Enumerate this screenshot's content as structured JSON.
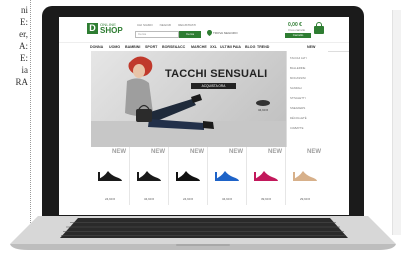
{
  "article_fragments": [
    "ni",
    "E:",
    "er,",
    "A:",
    "E:",
    "ia",
    "RA"
  ],
  "site": {
    "logo_letter": "D",
    "logo_top": "ONLINE",
    "logo_main": "SHOP",
    "top_links": [
      "CHI SIAMO",
      "NEGOZI",
      "REGISTRATI"
    ],
    "search_placeholder": "Cerca",
    "search_button": "Cerca",
    "store_label": "TROVA NEGOZIO",
    "cart_amount": "0,00 €",
    "cart_sub": "Il tuo carrello",
    "cart_button": "Carrello"
  },
  "nav": [
    "DONNA",
    "UOMO",
    "BAMBINI",
    "SPORT",
    "BORSE&ACC",
    "MARCHE",
    "XXL",
    "ULTIMI PAIA",
    "BLOG",
    "TREND",
    "NEW"
  ],
  "dropdown": [
    "TACCHI ALTI",
    "BALLERINE",
    "MOCASSINI",
    "SANDALI",
    "STIVALETTI",
    "SNEAKERS",
    "DÉCOLLETÉ",
    "CIABATTE"
  ],
  "hero": {
    "title": "TACCHI SENSUALI",
    "button": "ACQUISTA ORA",
    "price": "34,90 €"
  },
  "products": [
    {
      "badge": "NEW",
      "price": "24,90 €",
      "color": "#1a1a1a"
    },
    {
      "badge": "NEW",
      "price": "34,90 €",
      "color": "#1a1a1a"
    },
    {
      "badge": "NEW",
      "price": "24,90 €",
      "color": "#111111"
    },
    {
      "badge": "NEW",
      "price": "34,90 €",
      "color": "#1e63c8"
    },
    {
      "badge": "NEW",
      "price": "39,90 €",
      "color": "#c2185b"
    },
    {
      "badge": "NEW",
      "price": "29,90 €",
      "color": "#d7b08a"
    }
  ],
  "colors": {
    "brand": "#2e7d32",
    "laptop": "#1b1b1b"
  }
}
